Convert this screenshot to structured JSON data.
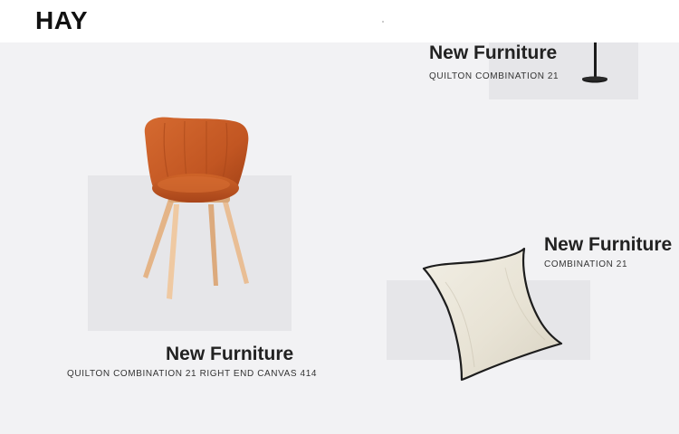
{
  "header": {
    "logo": "HAY"
  },
  "cards": [
    {
      "title": "New Furniture",
      "subtitle": "QUILTON COMBINATION 21",
      "image_icon": "floor-lamp-icon"
    },
    {
      "title": "New Furniture",
      "subtitle": "QUILTON COMBINATION 21 RIGHT END CANVAS 414",
      "image_icon": "chair-icon"
    },
    {
      "title": "New Furniture",
      "subtitle": "COMBINATION 21",
      "image_icon": "cushion-icon"
    }
  ],
  "colors": {
    "background": "#f2f2f4",
    "header": "#ffffff",
    "card_backdrop": "#e6e6e9",
    "chair_shell": "#c75a24",
    "chair_legs": "#e9be95",
    "cushion": "#ece8dc",
    "cushion_edge": "#1d1d1d",
    "lamp": "#1b1b1b"
  }
}
